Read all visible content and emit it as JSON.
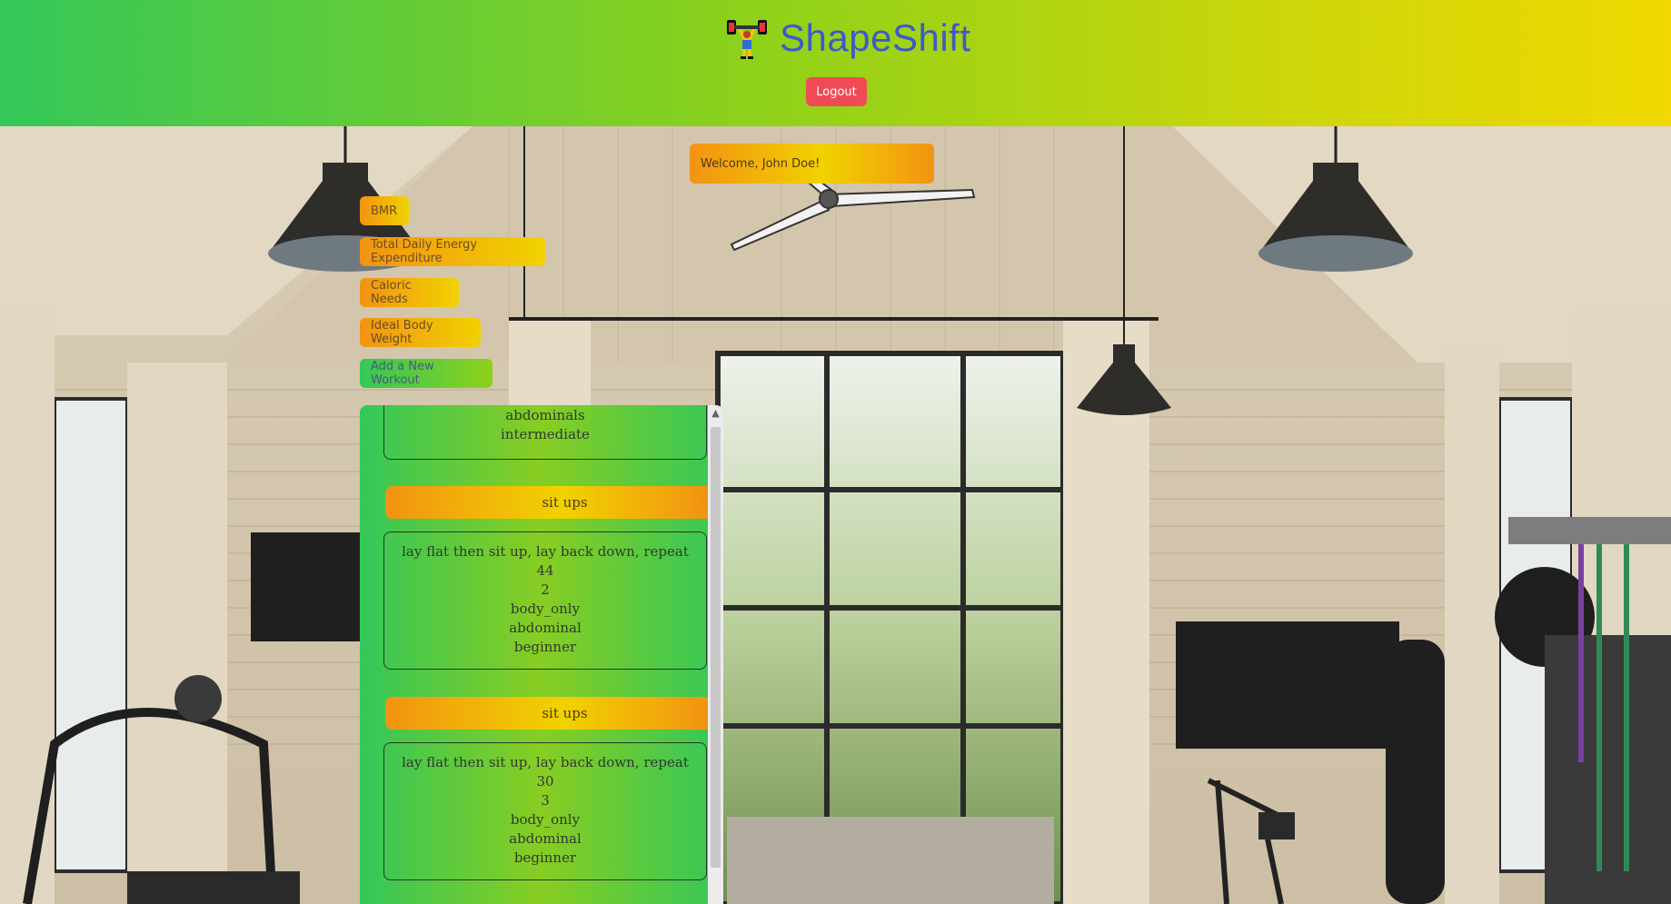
{
  "app": {
    "name": "ShapeShift",
    "logout_label": "Logout"
  },
  "welcome": "Welcome, John Doe!",
  "nav": {
    "bmr": "BMR",
    "tdee": "Total Daily Energy Expenditure",
    "caloric": "Caloric Needs",
    "ideal_weight": "Ideal Body Weight",
    "add_workout": "Add a New Workout"
  },
  "workouts": {
    "partial": {
      "muscle": "abdominals",
      "level": "intermediate"
    },
    "items": [
      {
        "name": "sit ups",
        "description": "lay flat then sit up, lay back down, repeat",
        "reps": "44",
        "sets": "2",
        "equipment": "body_only",
        "muscle": "abdominal",
        "level": "beginner"
      },
      {
        "name": "sit ups",
        "description": "lay flat then sit up, lay back down, repeat",
        "reps": "30",
        "sets": "3",
        "equipment": "body_only",
        "muscle": "abdominal",
        "level": "beginner"
      }
    ]
  },
  "icons": {
    "logo": "weightlifter-logo",
    "scroll_up": "chevron-up-icon"
  },
  "colors": {
    "logout": "#ef4a55",
    "brand_text": "#3f59c9",
    "orange": "#f29312",
    "yellow": "#f1d200",
    "green": "#34c759"
  }
}
